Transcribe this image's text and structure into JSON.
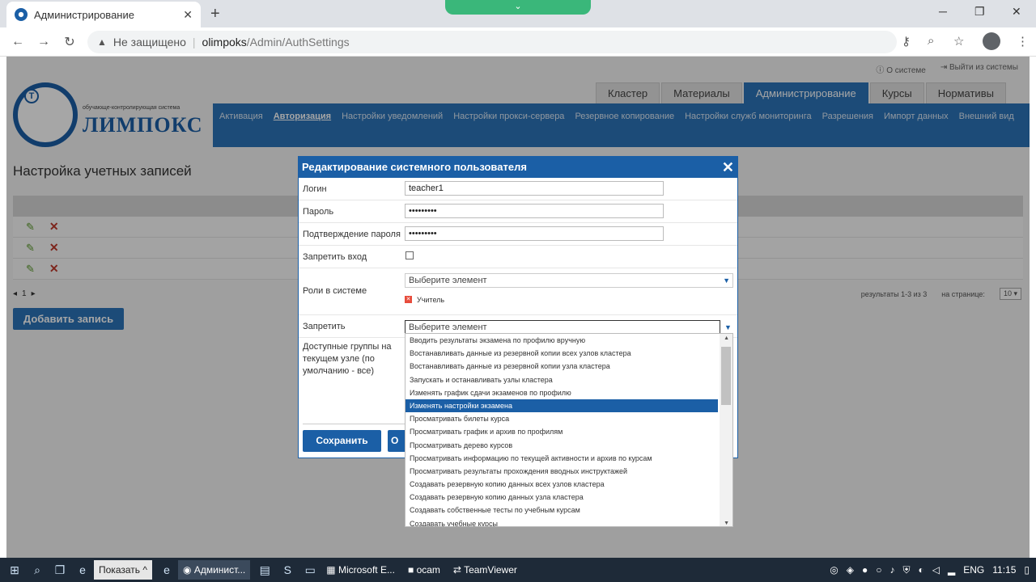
{
  "browser": {
    "tab_title": "Администрирование",
    "insecure_label": "Не защищено",
    "url_host": "olimpoks",
    "url_path": "/Admin/AuthSettings"
  },
  "header": {
    "about_link": "О системе",
    "logout_link": "Выйти из системы",
    "logo_subtitle": "обучающе-контролирующая система",
    "logo_name": "ЛИМПОКС",
    "logo_letter": "T",
    "main_tabs": [
      "Кластер",
      "Материалы",
      "Администрирование",
      "Курсы",
      "Нормативы"
    ],
    "sub_nav": [
      "Активация",
      "Авторизация",
      "Настройки уведомлений",
      "Настройки прокси-сервера",
      "Резервное копирование",
      "Настройки служб мониторинга",
      "Разрешения",
      "Импорт данных",
      "Внешний вид"
    ]
  },
  "page": {
    "title": "Настройка учетных записей",
    "pager_current": "1",
    "results_label": "результаты 1-3 из 3",
    "per_page_label": "на странице:",
    "per_page_value": "10",
    "add_button": "Добавить запись"
  },
  "dialog": {
    "title": "Редактирование системного пользователя",
    "login_label": "Логин",
    "login_value": "teacher1",
    "password_label": "Пароль",
    "password_value": "•••••••••",
    "confirm_label": "Подтверждение пароля",
    "confirm_value": "•••••••••",
    "deny_login_label": "Запретить вход",
    "roles_label": "Роли в системе",
    "roles_placeholder": "Выберите элемент",
    "role_tag": "Учитель",
    "deny_label": "Запретить",
    "deny_placeholder": "Выберите элемент",
    "groups_label": "Доступные группы на текущем узле (по умолчанию - все)",
    "save_button": "Сохранить",
    "cancel_button_partial": "О"
  },
  "dropdown_items": [
    "Вводить результаты экзамена по профилю вручную",
    "Востанавливать данные из резервной копии всех узлов кластера",
    "Востанавливать данные из резервной копии узла кластера",
    "Запускать и останавливать узлы кластера",
    "Изменять график сдачи экзаменов по профилю",
    "Изменять настройки экзамена",
    "Просматривать билеты курса",
    "Просматривать график и архив по профилям",
    "Просматривать дерево курсов",
    "Просматривать информацию по текущей активности и архив по курсам",
    "Просматривать результаты прохождения вводных инструктажей",
    "Создавать резервную копию данных всех узлов кластера",
    "Создавать резервную копию данных узла кластера",
    "Создавать собственные тесты по учебным курсам",
    "Создавать учебные курсы"
  ],
  "dropdown_highlighted_index": 5,
  "taskbar": {
    "show_button": "Показать",
    "apps": [
      "Админист...",
      "Microsoft E...",
      "ocam",
      "TeamViewer"
    ],
    "lang": "ENG",
    "time": "11:15"
  },
  "colors": {
    "brand_blue": "#1b5fa6",
    "nav_blue": "#2b73b8",
    "delete_red": "#c0392b",
    "edit_green": "#5a9a2a"
  },
  "icons": [
    "search-icon",
    "star-icon",
    "key-icon",
    "pencil-icon",
    "delete-x-icon",
    "info-icon",
    "exit-icon"
  ]
}
